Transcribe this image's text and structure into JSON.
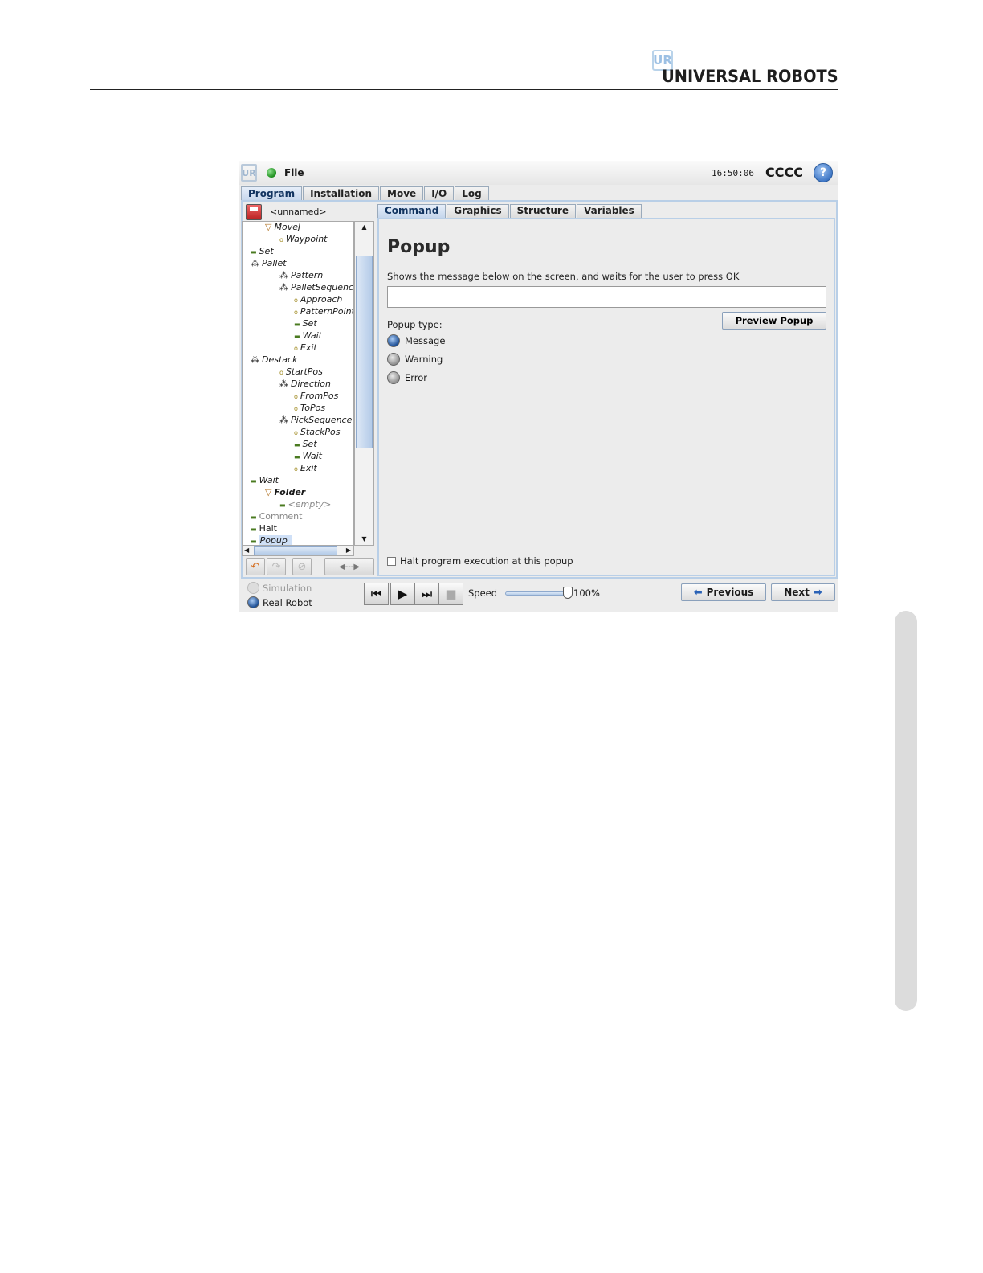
{
  "document": {
    "brand_mark": "UR",
    "brand_name": "UNIVERSAL ROBOTS"
  },
  "app": {
    "logo_mark": "UR",
    "menu_file": "File",
    "time": "16:50:06",
    "robot_name": "CCCC",
    "help_icon": "?",
    "main_tabs": [
      "Program",
      "Installation",
      "Move",
      "I/O",
      "Log"
    ],
    "active_main_tab": "Program",
    "program_name": "<unnamed>",
    "sub_tabs": [
      "Command",
      "Graphics",
      "Structure",
      "Variables"
    ],
    "active_sub_tab": "Command",
    "tree": [
      {
        "label": "MoveJ",
        "icon": "▽",
        "style": "italic"
      },
      {
        "label": "Waypoint",
        "icon": "o",
        "style": "italic"
      },
      {
        "label": "Set",
        "icon": "▬",
        "style": "italic"
      },
      {
        "label": "Pallet",
        "icon": "⁂",
        "style": "italic"
      },
      {
        "label": "Pattern",
        "icon": "⁂",
        "style": "italic"
      },
      {
        "label": "PalletSequence",
        "icon": "⁂",
        "style": "italic"
      },
      {
        "label": "Approach",
        "icon": "o",
        "style": "italic"
      },
      {
        "label": "PatternPoint",
        "icon": "o",
        "style": "italic"
      },
      {
        "label": "Set",
        "icon": "▬",
        "style": "italic"
      },
      {
        "label": "Wait",
        "icon": "▬",
        "style": "italic"
      },
      {
        "label": "Exit",
        "icon": "o",
        "style": "italic"
      },
      {
        "label": "Destack",
        "icon": "⁂",
        "style": "italic"
      },
      {
        "label": "StartPos",
        "icon": "o",
        "style": "italic"
      },
      {
        "label": "Direction",
        "icon": "⁂",
        "style": "italic"
      },
      {
        "label": "FromPos",
        "icon": "o",
        "style": "italic"
      },
      {
        "label": "ToPos",
        "icon": "o",
        "style": "italic"
      },
      {
        "label": "PickSequence",
        "icon": "⁂",
        "style": "italic"
      },
      {
        "label": "StackPos",
        "icon": "o",
        "style": "italic"
      },
      {
        "label": "Set",
        "icon": "▬",
        "style": "italic"
      },
      {
        "label": "Wait",
        "icon": "▬",
        "style": "italic"
      },
      {
        "label": "Exit",
        "icon": "o",
        "style": "italic"
      },
      {
        "label": "Wait",
        "icon": "▬",
        "style": "italic"
      },
      {
        "label": "Folder",
        "icon": "▽",
        "style": "bold-italic"
      },
      {
        "label": "<empty>",
        "icon": "▬",
        "style": "gray-italic"
      },
      {
        "label": "Comment",
        "icon": "▬",
        "style": "gray"
      },
      {
        "label": "Halt",
        "icon": "▬",
        "style": "normal"
      },
      {
        "label": "Popup",
        "icon": "▬",
        "style": "selected"
      }
    ],
    "tool_buttons": {
      "undo_icon": "↶",
      "redo_icon": "↷",
      "disable_icon": "⊘",
      "move_icon": "◀---▶"
    },
    "popup": {
      "title": "Popup",
      "description": "Shows the message below on the screen, and waits for the user to press OK",
      "message_value": "",
      "preview_label": "Preview Popup",
      "type_label": "Popup type:",
      "types": [
        "Message",
        "Warning",
        "Error"
      ],
      "selected_type": "Message",
      "halt_label": "Halt program execution at this popup",
      "halt_checked": false
    },
    "bottom": {
      "simulation_label": "Simulation",
      "real_robot_label": "Real Robot",
      "selected_mode": "Real Robot",
      "speed_label": "Speed",
      "speed_value": "100%",
      "speed_fraction": 1.0,
      "previous_label": "Previous",
      "next_label": "Next"
    }
  }
}
